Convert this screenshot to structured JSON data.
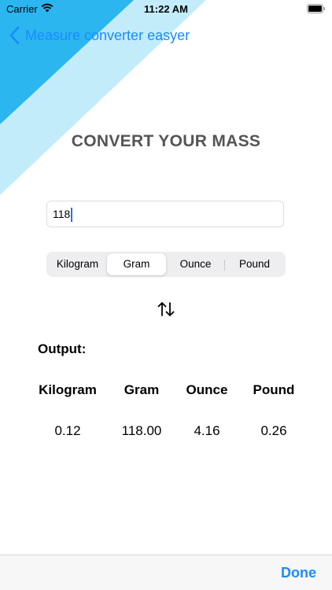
{
  "status_bar": {
    "carrier": "Carrier",
    "time": "11:22 AM"
  },
  "nav": {
    "back_label": "Measure converter easyer"
  },
  "title": "CONVERT YOUR MASS",
  "input": {
    "value": "118"
  },
  "units": [
    {
      "label": "Kilogram",
      "selected": false
    },
    {
      "label": "Gram",
      "selected": true
    },
    {
      "label": "Ounce",
      "selected": false
    },
    {
      "label": "Pound",
      "selected": false
    }
  ],
  "output": {
    "label": "Output:",
    "columns": [
      {
        "header": "Kilogram",
        "value": "0.12"
      },
      {
        "header": "Gram",
        "value": "118.00"
      },
      {
        "header": "Ounce",
        "value": "4.16"
      },
      {
        "header": "Pound",
        "value": "0.26"
      }
    ]
  },
  "toolbar": {
    "done_label": "Done"
  },
  "colors": {
    "accent": "#1a8cff",
    "triangle_dark": "#2bb6f0",
    "triangle_light": "#c3ecfb"
  },
  "icons": {
    "back": "chevron-left-icon",
    "wifi": "wifi-icon",
    "battery": "battery-icon",
    "swap": "swap-arrows-icon"
  }
}
